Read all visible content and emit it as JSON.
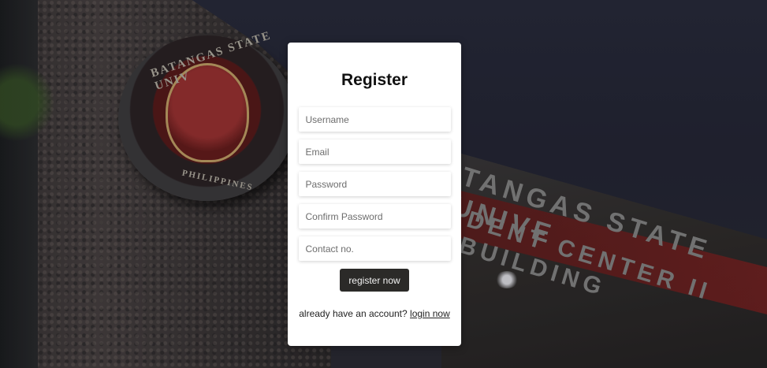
{
  "form": {
    "title": "Register",
    "fields": {
      "username_placeholder": "Username",
      "email_placeholder": "Email",
      "password_placeholder": "Password",
      "confirm_password_placeholder": "Confirm Password",
      "contact_placeholder": "Contact no."
    },
    "submit_label": "register now",
    "footer_text": "already have an account?",
    "login_link": "login now"
  },
  "background": {
    "seal_text_top": "BATANGAS STATE UNIV",
    "seal_text_bottom": "PHILIPPINES",
    "building_text_line1": "TANGAS STATE UNIVE",
    "building_text_line2": "DENT CENTER II BUILDING"
  },
  "colors": {
    "card_background": "#ffffff",
    "button_background": "#2b2a28",
    "button_text": "#f2f2f2"
  }
}
